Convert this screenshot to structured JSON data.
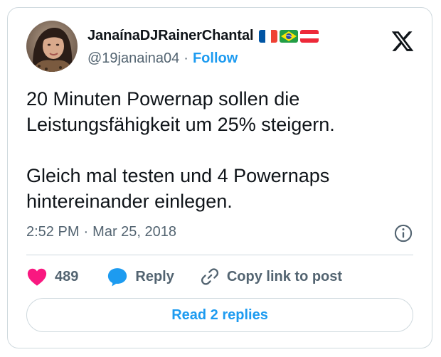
{
  "author": {
    "display_name": "JanaínaDJRainerChantal",
    "handle": "@19janaina04",
    "follow_label": "Follow",
    "flags": [
      "france-flag",
      "brazil-flag",
      "austria-flag"
    ]
  },
  "tweet": {
    "text": "20 Minuten Powernap sollen die\nLeistungsfähigkeit um 25% steigern.\n\nGleich mal testen und 4 Powernaps\nhintereinander einlegen.",
    "time": "2:52 PM",
    "separator": "·",
    "date": "Mar 25, 2018"
  },
  "actions": {
    "like_count": "489",
    "reply_label": "Reply",
    "copy_link_label": "Copy link to post"
  },
  "read_replies_label": "Read 2 replies",
  "colors": {
    "accent": "#1d9bf0",
    "like": "#f91880",
    "text": "#0f1419",
    "muted": "#536471",
    "border": "#cfd9de"
  },
  "icons": [
    "x-logo-icon",
    "info-icon",
    "heart-icon",
    "reply-bubble-icon",
    "link-icon"
  ]
}
